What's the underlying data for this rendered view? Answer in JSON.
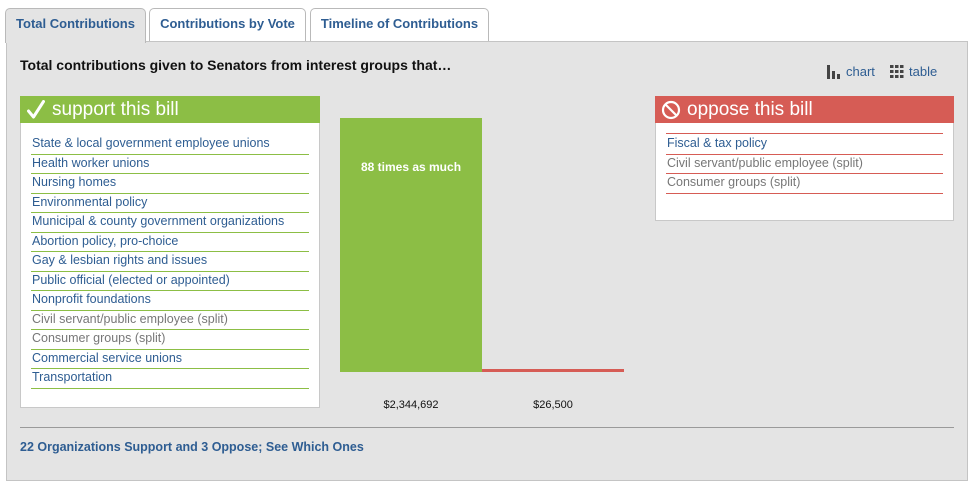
{
  "tabs": [
    {
      "label": "Total Contributions",
      "active": true
    },
    {
      "label": "Contributions by Vote",
      "active": false
    },
    {
      "label": "Timeline of Contributions",
      "active": false
    }
  ],
  "heading": "Total contributions given to Senators from interest groups that…",
  "view_options": {
    "chart": "chart",
    "table": "table"
  },
  "support": {
    "title": "support this bill",
    "icon": "check-icon",
    "color": "#8cbe45",
    "orgs": [
      {
        "label": "State & local government employee unions",
        "split": false
      },
      {
        "label": "Health worker unions",
        "split": false
      },
      {
        "label": "Nursing homes",
        "split": false
      },
      {
        "label": "Environmental policy",
        "split": false
      },
      {
        "label": "Municipal & county government organizations",
        "split": false
      },
      {
        "label": "Abortion policy, pro-choice",
        "split": false
      },
      {
        "label": "Gay & lesbian rights and issues",
        "split": false
      },
      {
        "label": "Public official (elected or appointed)",
        "split": false
      },
      {
        "label": "Nonprofit foundations",
        "split": false
      },
      {
        "label": "Civil servant/public employee (split)",
        "split": true
      },
      {
        "label": "Consumer groups (split)",
        "split": true
      },
      {
        "label": "Commercial service unions",
        "split": false
      },
      {
        "label": "Transportation",
        "split": false
      }
    ]
  },
  "oppose": {
    "title": "oppose this bill",
    "icon": "prohibited-icon",
    "color": "#d65c55",
    "orgs": [
      {
        "label": "Fiscal & tax policy",
        "split": false
      },
      {
        "label": "Civil servant/public employee (split)",
        "split": true
      },
      {
        "label": "Consumer groups (split)",
        "split": true
      }
    ]
  },
  "chart_data": {
    "type": "bar",
    "categories": [
      "support",
      "oppose"
    ],
    "values": [
      2344692,
      26500
    ],
    "value_labels": [
      "$2,344,692",
      "$26,500"
    ],
    "colors": [
      "#8cbe45",
      "#d65c55"
    ],
    "bar_annotation": "88 times as much"
  },
  "footer_link": "22 Organizations Support and 3 Oppose; See Which Ones"
}
